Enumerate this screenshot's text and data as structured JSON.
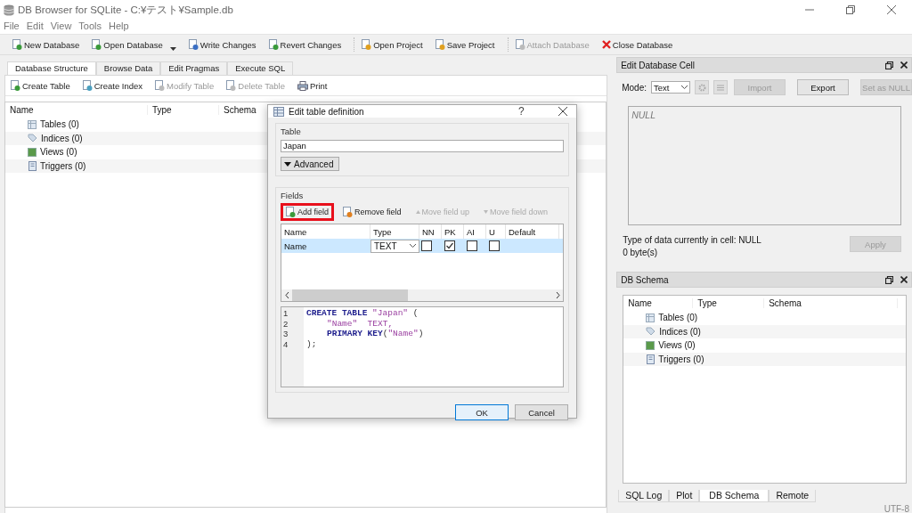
{
  "window": {
    "title": "DB Browser for SQLite - C:¥テスト¥Sample.db"
  },
  "menu": [
    "File",
    "Edit",
    "View",
    "Tools",
    "Help"
  ],
  "toolbar": [
    [
      {
        "label": "New Database",
        "disabled": false
      },
      {
        "label": "Open Database",
        "disabled": false,
        "dropdown": true
      },
      {
        "label": "Write Changes",
        "disabled": false
      },
      {
        "label": "Revert Changes",
        "disabled": false
      }
    ],
    [
      {
        "label": "Open Project",
        "disabled": false
      },
      {
        "label": "Save Project",
        "disabled": false
      }
    ],
    [
      {
        "label": "Attach Database",
        "disabled": true
      },
      {
        "label": "Close Database",
        "disabled": false
      }
    ]
  ],
  "main_tabs": [
    {
      "label": "Database Structure",
      "selected": true
    },
    {
      "label": "Browse Data",
      "selected": false
    },
    {
      "label": "Edit Pragmas",
      "selected": false
    },
    {
      "label": "Execute SQL",
      "selected": false
    }
  ],
  "structure_toolbar": [
    {
      "label": "Create Table",
      "disabled": false
    },
    {
      "label": "Create Index",
      "disabled": false
    },
    {
      "label": "Modify Table",
      "disabled": true
    },
    {
      "label": "Delete Table",
      "disabled": true
    },
    {
      "label": "Print",
      "disabled": false
    }
  ],
  "structure_tree": {
    "columns": [
      "Name",
      "Type",
      "Schema"
    ],
    "items": [
      "Tables (0)",
      "Indices (0)",
      "Views (0)",
      "Triggers (0)"
    ]
  },
  "dialog": {
    "title": "Edit table definition",
    "help": "?",
    "table_label": "Table",
    "table_name": "Japan",
    "advanced": "Advanced",
    "fields_label": "Fields",
    "field_actions": [
      {
        "label": "Add field",
        "disabled": false,
        "highlighted": true
      },
      {
        "label": "Remove field",
        "disabled": false,
        "highlighted": false
      },
      {
        "label": "Move field up",
        "disabled": true,
        "highlighted": false
      },
      {
        "label": "Move field down",
        "disabled": true,
        "highlighted": false
      }
    ],
    "field_columns": [
      "Name",
      "Type",
      "NN",
      "PK",
      "AI",
      "U",
      "Default"
    ],
    "field_rows": [
      {
        "name": "Name",
        "type": "TEXT",
        "nn": false,
        "pk": true,
        "ai": false,
        "u": false,
        "selected": true
      }
    ],
    "sql_lines": [
      {
        "number": "1",
        "indented": false,
        "tokens": [
          {
            "kind": "kw",
            "text": "CREATE TABLE"
          },
          {
            "kind": "str",
            "text": " \"Japan\""
          },
          {
            "kind": "plain",
            "text": " ("
          }
        ]
      },
      {
        "number": "2",
        "indented": true,
        "tokens": [
          {
            "kind": "str",
            "text": "\"Name\"  TEXT,"
          }
        ]
      },
      {
        "number": "3",
        "indented": true,
        "tokens": [
          {
            "kind": "kw",
            "text": "PRIMARY KEY"
          },
          {
            "kind": "plain",
            "text": "("
          },
          {
            "kind": "str",
            "text": "\"Name\""
          },
          {
            "kind": "plain",
            "text": ")"
          }
        ]
      },
      {
        "number": "4",
        "indented": false,
        "tokens": [
          {
            "kind": "plain",
            "text": ");"
          }
        ]
      }
    ],
    "buttons": [
      {
        "label": "OK",
        "default": true
      },
      {
        "label": "Cancel",
        "default": false
      }
    ]
  },
  "edit_cell": {
    "title": "Edit Database Cell",
    "mode_label": "Mode:",
    "mode": "Text",
    "buttons": [
      {
        "label": "Import",
        "disabled": true
      },
      {
        "label": "Export",
        "disabled": false
      },
      {
        "label": "Set as NULL",
        "disabled": true
      }
    ],
    "value": "NULL",
    "type_info": "Type of data currently in cell: NULL",
    "size_info": "0 byte(s)",
    "apply": {
      "label": "Apply",
      "disabled": true
    }
  },
  "db_schema": {
    "title": "DB Schema",
    "columns": [
      "Name",
      "Type",
      "Schema"
    ],
    "items": [
      "Tables (0)",
      "Indices (0)",
      "Views (0)",
      "Triggers (0)"
    ]
  },
  "dock_tabs": [
    {
      "label": "SQL Log",
      "selected": false
    },
    {
      "label": "Plot",
      "selected": false
    },
    {
      "label": "DB Schema",
      "selected": true
    },
    {
      "label": "Remote",
      "selected": false
    }
  ],
  "status": "UTF-8"
}
